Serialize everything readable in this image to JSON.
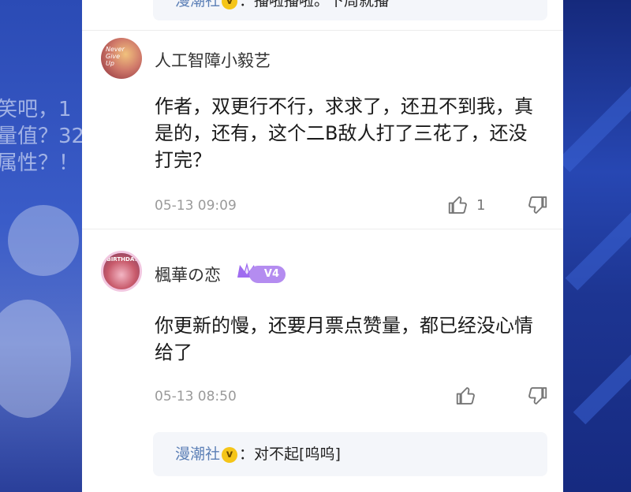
{
  "background": {
    "left_text": [
      "笑吧，1",
      "量值？32",
      "属性？！"
    ]
  },
  "top_reply": {
    "name": "漫潮社",
    "badge": "v",
    "separator": "：",
    "text": "播啦播啦。下周就播"
  },
  "comments": [
    {
      "username": "人工智障小毅艺",
      "avatar_text": [
        "Never",
        "Give",
        "Up"
      ],
      "text": "作者，双更行不行，求求了，还丑不到我，真是的，还有，这个二B敌人打了三花了，还没打完？",
      "time": "05-13 09:09",
      "likes": "1"
    },
    {
      "username": "楓華の恋",
      "avatar_text": "BIRTHDAY",
      "level": "V4",
      "text": "你更新的慢，还要月票点赞量，都已经没心情给了",
      "time": "05-13 08:50",
      "likes": ""
    }
  ],
  "bottom_reply": {
    "name": "漫潮社",
    "badge": "v",
    "separator": "：",
    "text": "对不起[呜呜]"
  },
  "colors": {
    "reply_name": "#5b7fb6",
    "badge_gold": "#f5c518",
    "level_purple": "#b48cf0",
    "panel_bg": "#ffffff",
    "page_bg": "#2a4fbf"
  }
}
